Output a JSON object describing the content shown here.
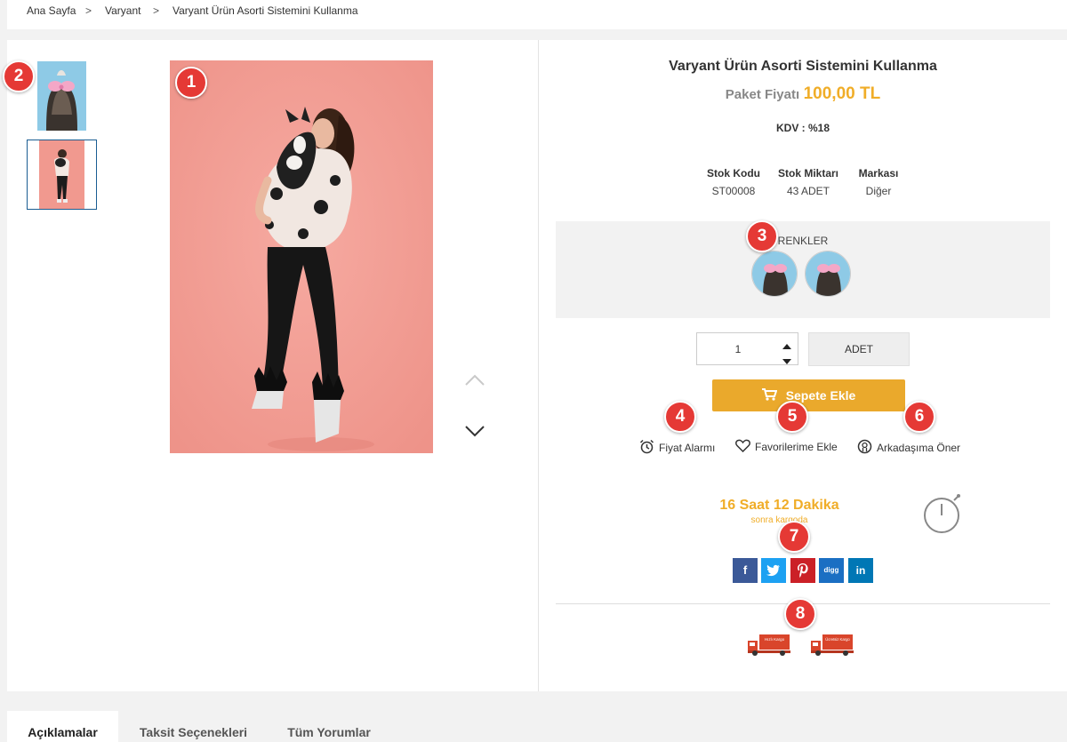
{
  "breadcrumb": {
    "items": [
      "Ana Sayfa",
      "Varyant",
      "Varyant Ürün Asorti Sistemini Kullanma"
    ],
    "separator": ">"
  },
  "markers": [
    "1",
    "2",
    "3",
    "4",
    "5",
    "6",
    "7",
    "8"
  ],
  "product": {
    "title": "Varyant Ürün Asorti Sistemini Kullanma",
    "price_label": "Paket Fiyatı",
    "price_value": "100,00 TL",
    "kdv": "KDV : %18",
    "specs": [
      {
        "label": "Stok Kodu",
        "value": "ST00008"
      },
      {
        "label": "Stok Miktarı",
        "value": "43 ADET"
      },
      {
        "label": "Markası",
        "value": "Diğer"
      }
    ],
    "colors_label": "RENKLER",
    "quantity": "1",
    "unit": "ADET",
    "add_to_cart": "Sepete Ekle"
  },
  "actions": {
    "price_alarm": "Fiyat Alarmı",
    "favorites": "Favorilerime Ekle",
    "recommend": "Arkadaşıma Öner"
  },
  "countdown": {
    "time": "16 Saat 12 Dakika",
    "suffix": "sonra kargoda"
  },
  "share": {
    "facebook": "f",
    "digg": "digg",
    "linkedin": "in"
  },
  "shipping_badges": [
    "Hızlı Kargo",
    "Ücretsiz Kargo"
  ],
  "tabs": [
    "Açıklamalar",
    "Taksit Seçenekleri",
    "Tüm Yorumlar"
  ],
  "colors": {
    "accent": "#eaa92c",
    "price": "#f0ad28",
    "marker": "#e53935",
    "facebook": "#3b5998",
    "twitter": "#1da1f2",
    "pinterest": "#cb2027",
    "digg": "#1b6fc3",
    "linkedin": "#0077b5",
    "truck": "#d9452b"
  }
}
